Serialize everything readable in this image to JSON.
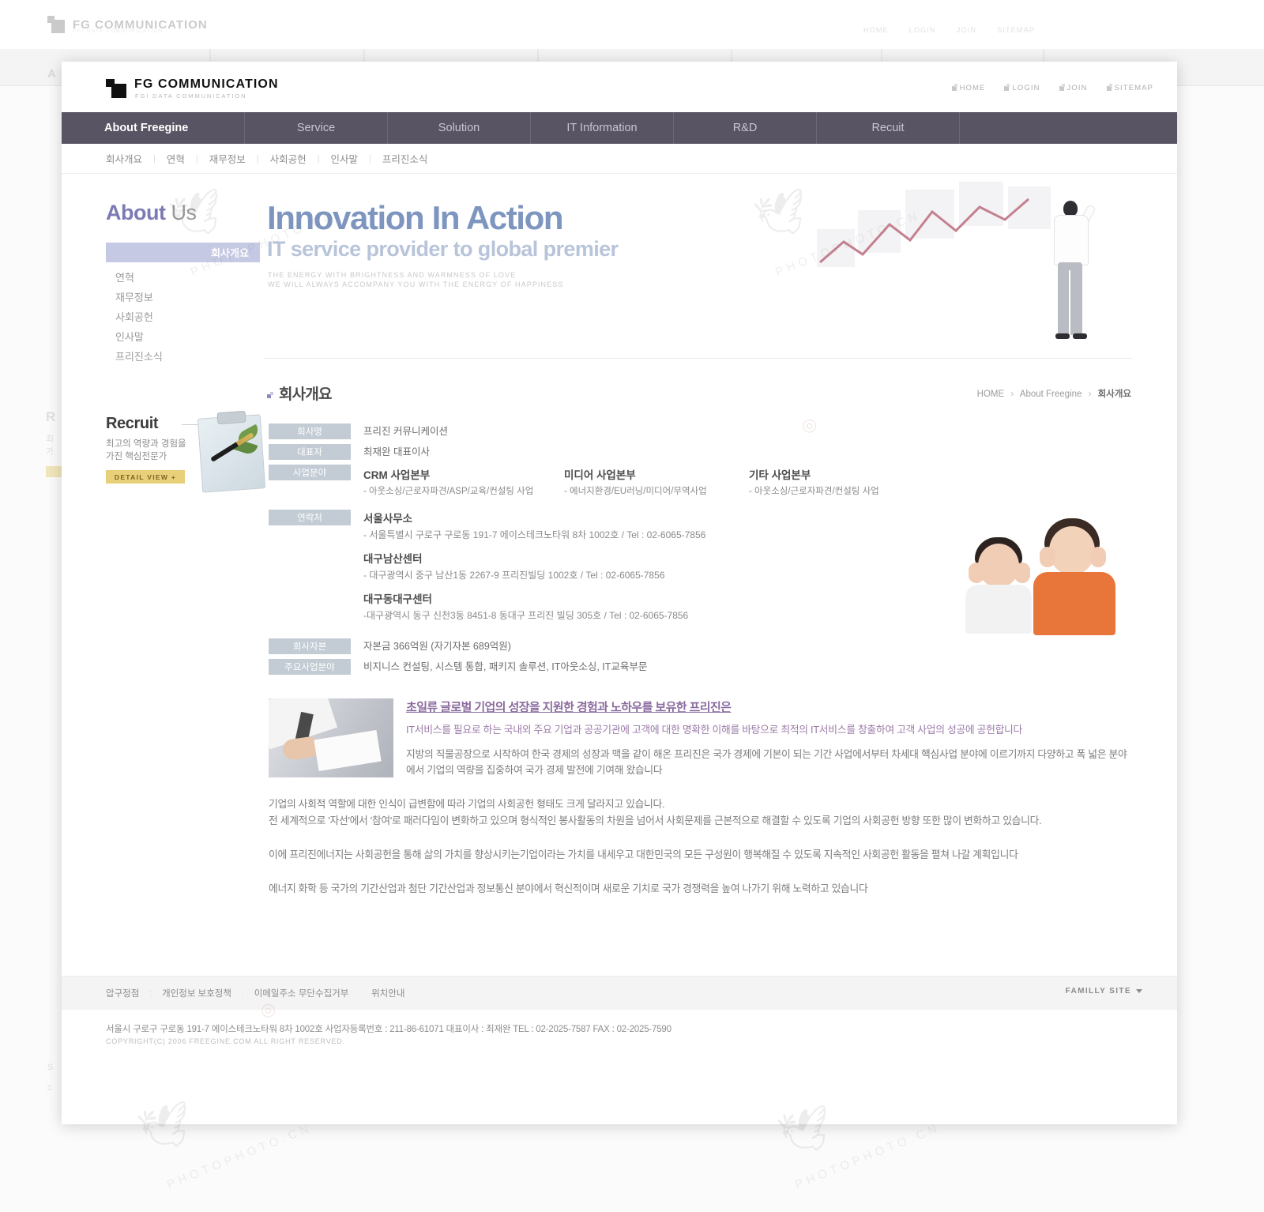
{
  "header": {
    "logo_title": "FG COMMUNICATION",
    "logo_sub": "FGI DATA COMMUNICATION",
    "utils": [
      {
        "label": "HOME"
      },
      {
        "label": "LOGIN"
      },
      {
        "label": "JOIN"
      },
      {
        "label": "SITEMAP"
      }
    ]
  },
  "gnb": [
    {
      "label": "About Freegine"
    },
    {
      "label": "Service"
    },
    {
      "label": "Solution"
    },
    {
      "label": "IT Information"
    },
    {
      "label": "R&D"
    },
    {
      "label": "Recuit"
    }
  ],
  "snb": [
    {
      "label": "회사개요"
    },
    {
      "label": "연혁"
    },
    {
      "label": "재무정보"
    },
    {
      "label": "사회공헌"
    },
    {
      "label": "인사말"
    },
    {
      "label": "프리진소식"
    }
  ],
  "sidebar": {
    "title_bold": "About",
    "title_light": "Us",
    "items": [
      {
        "label": "회사개요",
        "active": true
      },
      {
        "label": "연혁",
        "active": false
      },
      {
        "label": "재무정보",
        "active": false
      },
      {
        "label": "사회공헌",
        "active": false
      },
      {
        "label": "인사말",
        "active": false
      },
      {
        "label": "프리진소식",
        "active": false
      }
    ],
    "recruit": {
      "title": "Recruit",
      "desc_line1": "최고의 역량과 경험을",
      "desc_line2": "가진 핵심전문가",
      "button": "DETAIL VIEW +"
    }
  },
  "visual": {
    "headline": "Innovation In Action",
    "subhead": "IT service provider to global premier",
    "tag_line1": "THE ENERGY WITH BRIGHTNESS AND WARMNESS OF LOVE",
    "tag_line2": "WE WILL ALWAYS ACCOMPANY YOU WITH THE ENERGY OF HAPPINESS"
  },
  "page": {
    "title": "회사개요",
    "breadcrumb": {
      "home": "HOME",
      "section": "About Freegine",
      "current": "회사개요"
    }
  },
  "company": {
    "name_label": "회사명",
    "name_value": "프리진 커뮤니케이션",
    "ceo_label": "대표자",
    "ceo_value": "최재완 대표이사",
    "biz_label": "사업분야",
    "divisions": [
      {
        "title": "CRM 사업본부",
        "desc": "- 아웃소싱/근로자파견/ASP/교육/컨설팅 사업"
      },
      {
        "title": "미디어 사업본부",
        "desc": "- 에너지환경/EU러닝/미디어/무역사업"
      },
      {
        "title": "기타 사업본부",
        "desc": "- 아웃소싱/근로자파견/컨설팅 사업"
      }
    ],
    "contact_label": "연락처",
    "contacts": [
      {
        "title": "서울사무소",
        "desc": "- 서울특별시 구로구 구로동 191-7 에이스테크노타워 8차 1002호  /  Tel : 02-6065-7856"
      },
      {
        "title": "대구남산센터",
        "desc": "- 대구광역시 중구 남산1동 2267-9 프리진빌딩 1002호  /  Tel : 02-6065-7856"
      },
      {
        "title": "대구동대구센터",
        "desc": "-대구광역시 동구 신천3동 8451-8 동대구 프리진 빌딩 305호  /  Tel : 02-6065-7856"
      }
    ],
    "capital_label": "회사자본",
    "capital_value": "자본금 366억원 (자기자본 689억원)",
    "field_label": "주요사업분야",
    "field_value": "비지니스 컨설팅, 시스템 통합, 패키지 솔루션, IT아웃소싱, IT교육부문"
  },
  "article": {
    "heading": "초일류 글로벌 기업의 성장을 지원한 경험과 노하우를 보유한 프리진은",
    "lead": "IT서비스를 필요로 하는 국내외 주요 기업과 공공기관에 고객에 대한 명확한 이해를 바탕으로 최적의 IT서비스를 창출하여 고객 사업의 성공에 공헌합니다",
    "body": "지방의 직물공장으로 시작하여 한국 경제의 성장과 맥을 같이 해온 프리진은 국가 경제에 기본이 되는 기간 사업에서부터 차세대 핵심사업 분야에 이르기까지 다양하고 폭 넓은 분야에서 기업의 역량을 집중하여 국가 경제 발전에 기여해 왔습니다",
    "paragraphs": [
      "기업의 사회적 역할에 대한 인식이 급변함에 따라 기업의 사회공헌 형태도 크게 달라지고 있습니다.\n전 세계적으로 '자선'에서 '참여'로 패러다임이 변화하고 있으며 형식적인 봉사활동의 차원을 넘어서 사회문제를 근본적으로 해결할 수 있도록 기업의 사회공헌 방향 또한 많이 변화하고 있습니다.",
      "이에 프리진에너지는 사회공헌을 통해 삶의 가치를 향상시키는기업이라는 가치를 내세우고 대한민국의 모든 구성원이 행복해질 수 있도록 지속적인 사회공헌 활동을 펼쳐 나갈 계획입니다",
      "에너지 화학 등 국가의 기간산업과 첨단 기간산업과 정보통신 분야에서 혁신적이며 새로운 기치로 국가 경쟁력을 높여 나가기 위해 노력하고 있습니다"
    ]
  },
  "footer": {
    "links": [
      {
        "label": "압구정점"
      },
      {
        "label": "개인정보 보호정책"
      },
      {
        "label": "이메일주소 무단수집거부"
      },
      {
        "label": "위치안내"
      }
    ],
    "family_site": "FAMILLY SITE",
    "address": "서울시 구로구 구로동 191-7 에이스테크노타워 8차 1002호 사업자등록번호 : 211-86-61071  대표이사 : 최재완   TEL : 02-2025-7587   FAX : 02-2025-7590",
    "copyright": "COPYRIGHT(C) 2006 FREEGINE.COM ALL RIGHT RESERVED."
  },
  "watermark": {
    "text": "PHOTOPHOTO.CN",
    "short": "PHOTOPHOTO"
  }
}
